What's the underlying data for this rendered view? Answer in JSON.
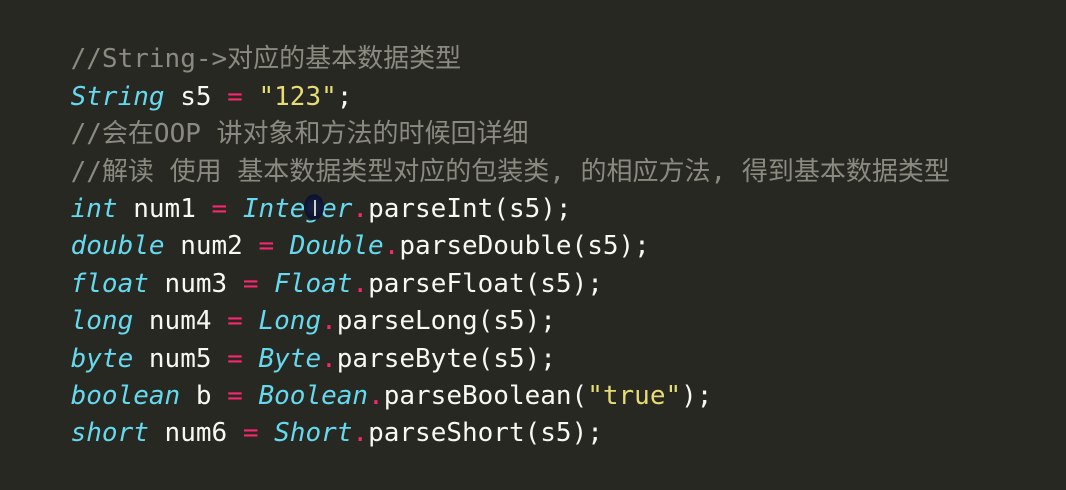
{
  "lines": [
    {
      "parts": [
        {
          "t": "//String->对应的基本数据类型",
          "c": "comment"
        }
      ]
    },
    {
      "parts": [
        {
          "t": "String",
          "c": "type"
        },
        {
          "t": " s5 ",
          "c": "plain"
        },
        {
          "t": "=",
          "c": "op"
        },
        {
          "t": " ",
          "c": "plain"
        },
        {
          "t": "\"123\"",
          "c": "str"
        },
        {
          "t": ";",
          "c": "plain"
        }
      ]
    },
    {
      "parts": [
        {
          "t": "//会在OOP 讲对象和方法的时候回详细",
          "c": "comment"
        }
      ]
    },
    {
      "parts": [
        {
          "t": "//解读 使用 基本数据类型对应的包装类, 的相应方法, 得到基本数据类型",
          "c": "comment"
        }
      ]
    },
    {
      "parts": [
        {
          "t": "int",
          "c": "type"
        },
        {
          "t": " num1 ",
          "c": "plain"
        },
        {
          "t": "=",
          "c": "op"
        },
        {
          "t": " ",
          "c": "plain"
        },
        {
          "t": "Integer",
          "c": "type"
        },
        {
          "t": ".",
          "c": "op"
        },
        {
          "t": "parseInt(s5);",
          "c": "plain"
        }
      ]
    },
    {
      "parts": [
        {
          "t": "double",
          "c": "type"
        },
        {
          "t": " num2 ",
          "c": "plain"
        },
        {
          "t": "=",
          "c": "op"
        },
        {
          "t": " ",
          "c": "plain"
        },
        {
          "t": "Double",
          "c": "type"
        },
        {
          "t": ".",
          "c": "op"
        },
        {
          "t": "parseDouble(s5);",
          "c": "plain"
        }
      ]
    },
    {
      "parts": [
        {
          "t": "float",
          "c": "type"
        },
        {
          "t": " num3 ",
          "c": "plain"
        },
        {
          "t": "=",
          "c": "op"
        },
        {
          "t": " ",
          "c": "plain"
        },
        {
          "t": "Float",
          "c": "type"
        },
        {
          "t": ".",
          "c": "op"
        },
        {
          "t": "parseFloat(s5);",
          "c": "plain"
        }
      ]
    },
    {
      "parts": [
        {
          "t": "long",
          "c": "type"
        },
        {
          "t": " num4 ",
          "c": "plain"
        },
        {
          "t": "=",
          "c": "op"
        },
        {
          "t": " ",
          "c": "plain"
        },
        {
          "t": "Long",
          "c": "type"
        },
        {
          "t": ".",
          "c": "op"
        },
        {
          "t": "parseLong(s5);",
          "c": "plain"
        }
      ]
    },
    {
      "parts": [
        {
          "t": "byte",
          "c": "type"
        },
        {
          "t": " num5 ",
          "c": "plain"
        },
        {
          "t": "=",
          "c": "op"
        },
        {
          "t": " ",
          "c": "plain"
        },
        {
          "t": "Byte",
          "c": "type"
        },
        {
          "t": ".",
          "c": "op"
        },
        {
          "t": "parseByte(s5);",
          "c": "plain"
        }
      ]
    },
    {
      "parts": [
        {
          "t": "boolean",
          "c": "type"
        },
        {
          "t": " b ",
          "c": "plain"
        },
        {
          "t": "=",
          "c": "op"
        },
        {
          "t": " ",
          "c": "plain"
        },
        {
          "t": "Boolean",
          "c": "type"
        },
        {
          "t": ".",
          "c": "op"
        },
        {
          "t": "parseBoolean(",
          "c": "plain"
        },
        {
          "t": "\"true\"",
          "c": "str"
        },
        {
          "t": ");",
          "c": "plain"
        }
      ]
    },
    {
      "parts": [
        {
          "t": "short",
          "c": "type"
        },
        {
          "t": " num6 ",
          "c": "plain"
        },
        {
          "t": "=",
          "c": "op"
        },
        {
          "t": " ",
          "c": "plain"
        },
        {
          "t": "Short",
          "c": "type"
        },
        {
          "t": ".",
          "c": "op"
        },
        {
          "t": "parseShort(s5);",
          "c": "plain"
        }
      ]
    }
  ],
  "theme": {
    "background": "#272822",
    "comment": "#8a8a80",
    "type": "#66d9ef",
    "operator": "#f92672",
    "string": "#e6db74",
    "plain": "#f8f8f2"
  },
  "cursor_icon": "mouse-cursor-icon"
}
